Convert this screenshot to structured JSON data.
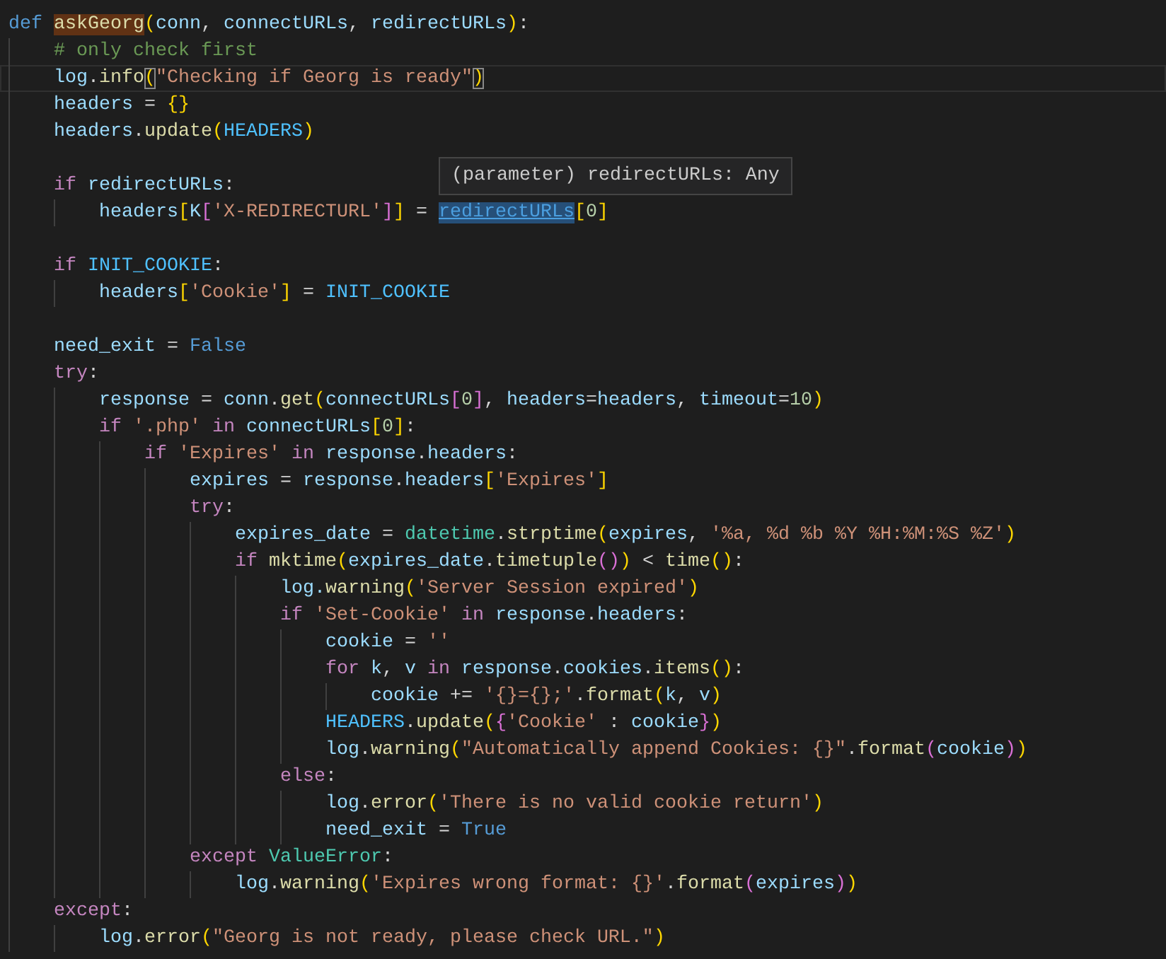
{
  "editor": {
    "hover_tooltip": "(parameter) redirectURLs: Any",
    "lines": [
      {
        "kind": "code",
        "current": false,
        "tokens": [
          {
            "kind": "def",
            "text": "def "
          },
          {
            "kind": "word-highlight",
            "text": "askGeorg"
          },
          {
            "kind": "b1",
            "text": "("
          },
          {
            "kind": "var",
            "text": "conn"
          },
          {
            "kind": "op",
            "text": ", "
          },
          {
            "kind": "var",
            "text": "connectURLs"
          },
          {
            "kind": "op",
            "text": ", "
          },
          {
            "kind": "var",
            "text": "redirectURLs"
          },
          {
            "kind": "b1",
            "text": ")"
          },
          {
            "kind": "op",
            "text": ":"
          }
        ],
        "children": [
          {
            "kind": "code",
            "current": false,
            "tokens": [
              {
                "kind": "com",
                "text": "# only check first"
              }
            ]
          },
          {
            "kind": "code",
            "current": true,
            "tokens": [
              {
                "kind": "var",
                "text": "log"
              },
              {
                "kind": "op",
                "text": "."
              },
              {
                "kind": "fn",
                "text": "info"
              },
              {
                "kind": "bracket-match",
                "text": "("
              },
              {
                "kind": "str",
                "text": "\"Checking if Georg is ready\""
              },
              {
                "kind": "bracket-match",
                "text": ")"
              }
            ]
          },
          {
            "kind": "code",
            "current": false,
            "tokens": [
              {
                "kind": "var",
                "text": "headers"
              },
              {
                "kind": "op",
                "text": " = "
              },
              {
                "kind": "b1",
                "text": "{}"
              }
            ]
          },
          {
            "kind": "code",
            "current": false,
            "tokens": [
              {
                "kind": "var",
                "text": "headers"
              },
              {
                "kind": "op",
                "text": "."
              },
              {
                "kind": "fn",
                "text": "update"
              },
              {
                "kind": "b1",
                "text": "("
              },
              {
                "kind": "const",
                "text": "HEADERS"
              },
              {
                "kind": "b1",
                "text": ")"
              }
            ]
          },
          {
            "kind": "blank",
            "current": false
          },
          {
            "kind": "code",
            "current": false,
            "tokens": [
              {
                "kind": "kw",
                "text": "if "
              },
              {
                "kind": "var",
                "text": "redirectURLs"
              },
              {
                "kind": "op",
                "text": ":"
              }
            ],
            "children": [
              {
                "kind": "code",
                "current": false,
                "tokens": [
                  {
                    "kind": "var",
                    "text": "headers"
                  },
                  {
                    "kind": "b1",
                    "text": "["
                  },
                  {
                    "kind": "var",
                    "text": "K"
                  },
                  {
                    "kind": "b2",
                    "text": "["
                  },
                  {
                    "kind": "str",
                    "text": "'X-REDIRECTURL'"
                  },
                  {
                    "kind": "b2",
                    "text": "]"
                  },
                  {
                    "kind": "b1",
                    "text": "]"
                  },
                  {
                    "kind": "op",
                    "text": " = "
                  },
                  {
                    "kind": "link",
                    "text": "redirectURLs"
                  },
                  {
                    "kind": "b1",
                    "text": "["
                  },
                  {
                    "kind": "num",
                    "text": "0"
                  },
                  {
                    "kind": "b1",
                    "text": "]"
                  }
                ]
              }
            ]
          },
          {
            "kind": "blank",
            "current": false
          },
          {
            "kind": "code",
            "current": false,
            "tokens": [
              {
                "kind": "kw",
                "text": "if "
              },
              {
                "kind": "const",
                "text": "INIT_COOKIE"
              },
              {
                "kind": "op",
                "text": ":"
              }
            ],
            "children": [
              {
                "kind": "code",
                "current": false,
                "tokens": [
                  {
                    "kind": "var",
                    "text": "headers"
                  },
                  {
                    "kind": "b1",
                    "text": "["
                  },
                  {
                    "kind": "str",
                    "text": "'Cookie'"
                  },
                  {
                    "kind": "b1",
                    "text": "]"
                  },
                  {
                    "kind": "op",
                    "text": " = "
                  },
                  {
                    "kind": "const",
                    "text": "INIT_COOKIE"
                  }
                ]
              }
            ]
          },
          {
            "kind": "blank",
            "current": false
          },
          {
            "kind": "code",
            "current": false,
            "tokens": [
              {
                "kind": "var",
                "text": "need_exit"
              },
              {
                "kind": "op",
                "text": " = "
              },
              {
                "kind": "def",
                "text": "False"
              }
            ]
          },
          {
            "kind": "code",
            "current": false,
            "tokens": [
              {
                "kind": "kw",
                "text": "try"
              },
              {
                "kind": "op",
                "text": ":"
              }
            ],
            "children": [
              {
                "kind": "code",
                "current": false,
                "tokens": [
                  {
                    "kind": "var",
                    "text": "response"
                  },
                  {
                    "kind": "op",
                    "text": " = "
                  },
                  {
                    "kind": "var",
                    "text": "conn"
                  },
                  {
                    "kind": "op",
                    "text": "."
                  },
                  {
                    "kind": "fn",
                    "text": "get"
                  },
                  {
                    "kind": "b1",
                    "text": "("
                  },
                  {
                    "kind": "var",
                    "text": "connectURLs"
                  },
                  {
                    "kind": "b2",
                    "text": "["
                  },
                  {
                    "kind": "num",
                    "text": "0"
                  },
                  {
                    "kind": "b2",
                    "text": "]"
                  },
                  {
                    "kind": "op",
                    "text": ", "
                  },
                  {
                    "kind": "var",
                    "text": "headers"
                  },
                  {
                    "kind": "op",
                    "text": "="
                  },
                  {
                    "kind": "var",
                    "text": "headers"
                  },
                  {
                    "kind": "op",
                    "text": ", "
                  },
                  {
                    "kind": "var",
                    "text": "timeout"
                  },
                  {
                    "kind": "op",
                    "text": "="
                  },
                  {
                    "kind": "num",
                    "text": "10"
                  },
                  {
                    "kind": "b1",
                    "text": ")"
                  }
                ]
              },
              {
                "kind": "code",
                "current": false,
                "tokens": [
                  {
                    "kind": "kw",
                    "text": "if "
                  },
                  {
                    "kind": "str",
                    "text": "'.php' "
                  },
                  {
                    "kind": "kw",
                    "text": "in "
                  },
                  {
                    "kind": "var",
                    "text": "connectURLs"
                  },
                  {
                    "kind": "b1",
                    "text": "["
                  },
                  {
                    "kind": "num",
                    "text": "0"
                  },
                  {
                    "kind": "b1",
                    "text": "]"
                  },
                  {
                    "kind": "op",
                    "text": ":"
                  }
                ],
                "children": [
                  {
                    "kind": "code",
                    "current": false,
                    "tokens": [
                      {
                        "kind": "kw",
                        "text": "if "
                      },
                      {
                        "kind": "str",
                        "text": "'Expires' "
                      },
                      {
                        "kind": "kw",
                        "text": "in "
                      },
                      {
                        "kind": "var",
                        "text": "response"
                      },
                      {
                        "kind": "op",
                        "text": "."
                      },
                      {
                        "kind": "var",
                        "text": "headers"
                      },
                      {
                        "kind": "op",
                        "text": ":"
                      }
                    ],
                    "children": [
                      {
                        "kind": "code",
                        "current": false,
                        "tokens": [
                          {
                            "kind": "var",
                            "text": "expires"
                          },
                          {
                            "kind": "op",
                            "text": " = "
                          },
                          {
                            "kind": "var",
                            "text": "response"
                          },
                          {
                            "kind": "op",
                            "text": "."
                          },
                          {
                            "kind": "var",
                            "text": "headers"
                          },
                          {
                            "kind": "b1",
                            "text": "["
                          },
                          {
                            "kind": "str",
                            "text": "'Expires'"
                          },
                          {
                            "kind": "b1",
                            "text": "]"
                          }
                        ]
                      },
                      {
                        "kind": "code",
                        "current": false,
                        "tokens": [
                          {
                            "kind": "kw",
                            "text": "try"
                          },
                          {
                            "kind": "op",
                            "text": ":"
                          }
                        ],
                        "children": [
                          {
                            "kind": "code",
                            "current": false,
                            "tokens": [
                              {
                                "kind": "var",
                                "text": "expires_date"
                              },
                              {
                                "kind": "op",
                                "text": " = "
                              },
                              {
                                "kind": "cls",
                                "text": "datetime"
                              },
                              {
                                "kind": "op",
                                "text": "."
                              },
                              {
                                "kind": "fn",
                                "text": "strptime"
                              },
                              {
                                "kind": "b1",
                                "text": "("
                              },
                              {
                                "kind": "var",
                                "text": "expires"
                              },
                              {
                                "kind": "op",
                                "text": ", "
                              },
                              {
                                "kind": "str",
                                "text": "'%a, %d %b %Y %H:%M:%S %Z'"
                              },
                              {
                                "kind": "b1",
                                "text": ")"
                              }
                            ]
                          },
                          {
                            "kind": "code",
                            "current": false,
                            "tokens": [
                              {
                                "kind": "kw",
                                "text": "if "
                              },
                              {
                                "kind": "fn",
                                "text": "mktime"
                              },
                              {
                                "kind": "b1",
                                "text": "("
                              },
                              {
                                "kind": "var",
                                "text": "expires_date"
                              },
                              {
                                "kind": "op",
                                "text": "."
                              },
                              {
                                "kind": "fn",
                                "text": "timetuple"
                              },
                              {
                                "kind": "b2",
                                "text": "()"
                              },
                              {
                                "kind": "b1",
                                "text": ")"
                              },
                              {
                                "kind": "op",
                                "text": " < "
                              },
                              {
                                "kind": "fn",
                                "text": "time"
                              },
                              {
                                "kind": "b1",
                                "text": "()"
                              },
                              {
                                "kind": "op",
                                "text": ":"
                              }
                            ],
                            "children": [
                              {
                                "kind": "code",
                                "current": false,
                                "tokens": [
                                  {
                                    "kind": "var",
                                    "text": "log."
                                  },
                                  {
                                    "kind": "fn",
                                    "text": "warning"
                                  },
                                  {
                                    "kind": "b1",
                                    "text": "("
                                  },
                                  {
                                    "kind": "str",
                                    "text": "'Server Session expired'"
                                  },
                                  {
                                    "kind": "b1",
                                    "text": ")"
                                  }
                                ]
                              },
                              {
                                "kind": "code",
                                "current": false,
                                "tokens": [
                                  {
                                    "kind": "kw",
                                    "text": "if "
                                  },
                                  {
                                    "kind": "str",
                                    "text": "'Set-Cookie' "
                                  },
                                  {
                                    "kind": "kw",
                                    "text": "in "
                                  },
                                  {
                                    "kind": "var",
                                    "text": "response"
                                  },
                                  {
                                    "kind": "op",
                                    "text": "."
                                  },
                                  {
                                    "kind": "var",
                                    "text": "headers"
                                  },
                                  {
                                    "kind": "op",
                                    "text": ":"
                                  }
                                ],
                                "children": [
                                  {
                                    "kind": "code",
                                    "current": false,
                                    "tokens": [
                                      {
                                        "kind": "var",
                                        "text": "cookie"
                                      },
                                      {
                                        "kind": "op",
                                        "text": " = "
                                      },
                                      {
                                        "kind": "str",
                                        "text": "''"
                                      }
                                    ]
                                  },
                                  {
                                    "kind": "code",
                                    "current": false,
                                    "tokens": [
                                      {
                                        "kind": "kw",
                                        "text": "for "
                                      },
                                      {
                                        "kind": "var",
                                        "text": "k"
                                      },
                                      {
                                        "kind": "op",
                                        "text": ", "
                                      },
                                      {
                                        "kind": "var",
                                        "text": "v "
                                      },
                                      {
                                        "kind": "kw",
                                        "text": "in "
                                      },
                                      {
                                        "kind": "var",
                                        "text": "response"
                                      },
                                      {
                                        "kind": "op",
                                        "text": "."
                                      },
                                      {
                                        "kind": "var",
                                        "text": "cookies"
                                      },
                                      {
                                        "kind": "op",
                                        "text": "."
                                      },
                                      {
                                        "kind": "fn",
                                        "text": "items"
                                      },
                                      {
                                        "kind": "b1",
                                        "text": "()"
                                      },
                                      {
                                        "kind": "op",
                                        "text": ":"
                                      }
                                    ],
                                    "children": [
                                      {
                                        "kind": "code",
                                        "current": false,
                                        "tokens": [
                                          {
                                            "kind": "var",
                                            "text": "cookie"
                                          },
                                          {
                                            "kind": "op",
                                            "text": " += "
                                          },
                                          {
                                            "kind": "str",
                                            "text": "'{}={};'"
                                          },
                                          {
                                            "kind": "op",
                                            "text": "."
                                          },
                                          {
                                            "kind": "fn",
                                            "text": "format"
                                          },
                                          {
                                            "kind": "b1",
                                            "text": "("
                                          },
                                          {
                                            "kind": "var",
                                            "text": "k"
                                          },
                                          {
                                            "kind": "op",
                                            "text": ", "
                                          },
                                          {
                                            "kind": "var",
                                            "text": "v"
                                          },
                                          {
                                            "kind": "b1",
                                            "text": ")"
                                          }
                                        ]
                                      }
                                    ]
                                  },
                                  {
                                    "kind": "code",
                                    "current": false,
                                    "tokens": [
                                      {
                                        "kind": "const",
                                        "text": "HEADERS"
                                      },
                                      {
                                        "kind": "op",
                                        "text": "."
                                      },
                                      {
                                        "kind": "fn",
                                        "text": "update"
                                      },
                                      {
                                        "kind": "b1",
                                        "text": "("
                                      },
                                      {
                                        "kind": "b2",
                                        "text": "{"
                                      },
                                      {
                                        "kind": "str",
                                        "text": "'Cookie'"
                                      },
                                      {
                                        "kind": "op",
                                        "text": " : "
                                      },
                                      {
                                        "kind": "var",
                                        "text": "cookie"
                                      },
                                      {
                                        "kind": "b2",
                                        "text": "}"
                                      },
                                      {
                                        "kind": "b1",
                                        "text": ")"
                                      }
                                    ]
                                  },
                                  {
                                    "kind": "code",
                                    "current": false,
                                    "tokens": [
                                      {
                                        "kind": "var",
                                        "text": "log"
                                      },
                                      {
                                        "kind": "op",
                                        "text": "."
                                      },
                                      {
                                        "kind": "fn",
                                        "text": "warning"
                                      },
                                      {
                                        "kind": "b1",
                                        "text": "("
                                      },
                                      {
                                        "kind": "str",
                                        "text": "\"Automatically append Cookies: {}\""
                                      },
                                      {
                                        "kind": "op",
                                        "text": "."
                                      },
                                      {
                                        "kind": "fn",
                                        "text": "format"
                                      },
                                      {
                                        "kind": "b2",
                                        "text": "("
                                      },
                                      {
                                        "kind": "var",
                                        "text": "cookie"
                                      },
                                      {
                                        "kind": "b2",
                                        "text": ")"
                                      },
                                      {
                                        "kind": "b1",
                                        "text": ")"
                                      }
                                    ]
                                  }
                                ]
                              },
                              {
                                "kind": "code",
                                "current": false,
                                "tokens": [
                                  {
                                    "kind": "kw",
                                    "text": "else"
                                  },
                                  {
                                    "kind": "op",
                                    "text": ":"
                                  }
                                ],
                                "children": [
                                  {
                                    "kind": "code",
                                    "current": false,
                                    "tokens": [
                                      {
                                        "kind": "var",
                                        "text": "log"
                                      },
                                      {
                                        "kind": "op",
                                        "text": "."
                                      },
                                      {
                                        "kind": "fn",
                                        "text": "error"
                                      },
                                      {
                                        "kind": "b1",
                                        "text": "("
                                      },
                                      {
                                        "kind": "str",
                                        "text": "'There is no valid cookie return'"
                                      },
                                      {
                                        "kind": "b1",
                                        "text": ")"
                                      }
                                    ]
                                  },
                                  {
                                    "kind": "code",
                                    "current": false,
                                    "tokens": [
                                      {
                                        "kind": "var",
                                        "text": "need_exit"
                                      },
                                      {
                                        "kind": "op",
                                        "text": " = "
                                      },
                                      {
                                        "kind": "def",
                                        "text": "True"
                                      }
                                    ]
                                  }
                                ]
                              }
                            ]
                          }
                        ]
                      },
                      {
                        "kind": "code",
                        "current": false,
                        "tokens": [
                          {
                            "kind": "kw",
                            "text": "except "
                          },
                          {
                            "kind": "cls",
                            "text": "ValueError"
                          },
                          {
                            "kind": "op",
                            "text": ":"
                          }
                        ],
                        "children": [
                          {
                            "kind": "code",
                            "current": false,
                            "tokens": [
                              {
                                "kind": "var",
                                "text": "log"
                              },
                              {
                                "kind": "op",
                                "text": "."
                              },
                              {
                                "kind": "fn",
                                "text": "warning"
                              },
                              {
                                "kind": "b1",
                                "text": "("
                              },
                              {
                                "kind": "str",
                                "text": "'Expires wrong format: {}'"
                              },
                              {
                                "kind": "op",
                                "text": "."
                              },
                              {
                                "kind": "fn",
                                "text": "format"
                              },
                              {
                                "kind": "b2",
                                "text": "("
                              },
                              {
                                "kind": "var",
                                "text": "expires"
                              },
                              {
                                "kind": "b2",
                                "text": ")"
                              },
                              {
                                "kind": "b1",
                                "text": ")"
                              }
                            ]
                          }
                        ]
                      }
                    ]
                  }
                ]
              }
            ]
          },
          {
            "kind": "code",
            "current": false,
            "tokens": [
              {
                "kind": "kw",
                "text": "except"
              },
              {
                "kind": "op",
                "text": ":"
              }
            ],
            "children": [
              {
                "kind": "code",
                "current": false,
                "tokens": [
                  {
                    "kind": "var",
                    "text": "log"
                  },
                  {
                    "kind": "op",
                    "text": "."
                  },
                  {
                    "kind": "fn",
                    "text": "error"
                  },
                  {
                    "kind": "b1",
                    "text": "("
                  },
                  {
                    "kind": "str",
                    "text": "\"Georg is not ready, please check URL.\""
                  },
                  {
                    "kind": "b1",
                    "text": ")"
                  }
                ]
              }
            ]
          }
        ]
      }
    ]
  }
}
